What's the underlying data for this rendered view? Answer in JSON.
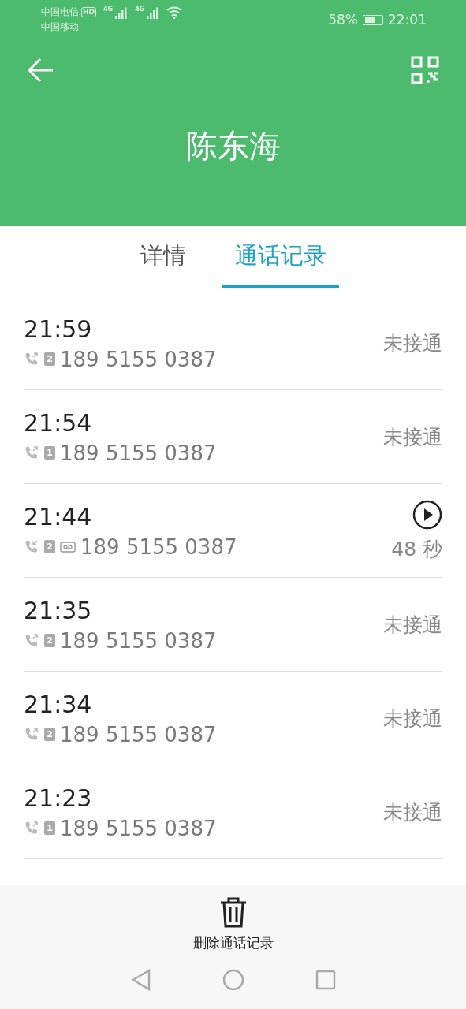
{
  "status_bar": {
    "carriers": [
      "中国电信",
      "中国移动"
    ],
    "hd": "HD",
    "networks": [
      "4G",
      "4G"
    ],
    "battery_text": "58%",
    "time": "22:01"
  },
  "header": {
    "title": "陈东海"
  },
  "tabs": [
    {
      "label": "详情",
      "selected": false
    },
    {
      "label": "通话记录",
      "selected": true
    }
  ],
  "calls": [
    {
      "time": "21:59",
      "incoming": false,
      "sim": "2",
      "voicemail": false,
      "number": "189 5155 0387",
      "kind": "status",
      "status": "未接通"
    },
    {
      "time": "21:54",
      "incoming": false,
      "sim": "1",
      "voicemail": false,
      "number": "189 5155 0387",
      "kind": "status",
      "status": "未接通"
    },
    {
      "time": "21:44",
      "incoming": true,
      "sim": "2",
      "voicemail": true,
      "number": "189 5155 0387",
      "kind": "recording",
      "status": "48 秒"
    },
    {
      "time": "21:35",
      "incoming": false,
      "sim": "2",
      "voicemail": false,
      "number": "189 5155 0387",
      "kind": "status",
      "status": "未接通"
    },
    {
      "time": "21:34",
      "incoming": false,
      "sim": "2",
      "voicemail": false,
      "number": "189 5155 0387",
      "kind": "status",
      "status": "未接通"
    },
    {
      "time": "21:23",
      "incoming": false,
      "sim": "1",
      "voicemail": false,
      "number": "189 5155 0387",
      "kind": "status",
      "status": "未接通"
    }
  ],
  "bottom_action": {
    "label": "删除通话记录"
  }
}
